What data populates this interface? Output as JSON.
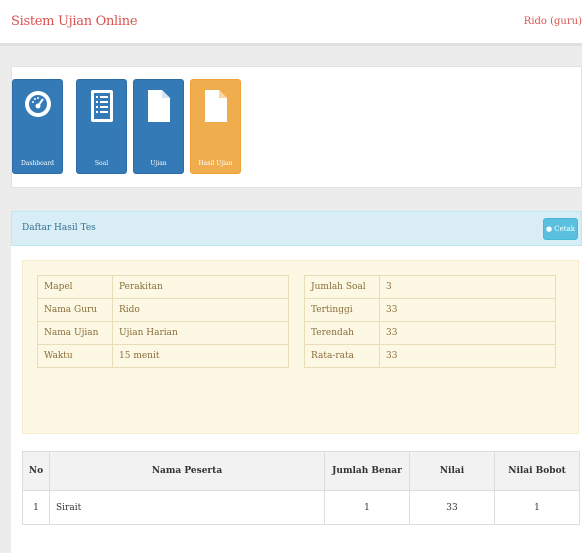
{
  "header": {
    "title": "Sistem Ujian Online",
    "user": "Rido (guru)"
  },
  "menu": {
    "tiles": [
      {
        "label": "Dashboard",
        "icon": "dashboard-icon",
        "color": "#337ab7"
      },
      {
        "label": "Soal",
        "icon": "list-icon",
        "color": "#337ab7"
      },
      {
        "label": "Ujian",
        "icon": "file-icon",
        "color": "#337ab7"
      },
      {
        "label": "Hasil Ujian",
        "icon": "file-icon",
        "color": "#f0ad4e"
      }
    ]
  },
  "panel": {
    "title": "Daftar Hasil Tes",
    "print_button": "Cetak"
  },
  "info": {
    "left": [
      {
        "label": "Mapel",
        "value": "Perakitan"
      },
      {
        "label": "Nama Guru",
        "value": "Rido"
      },
      {
        "label": "Nama Ujian",
        "value": "Ujian Harian"
      },
      {
        "label": "Waktu",
        "value": "15 menit"
      }
    ],
    "right": [
      {
        "label": "Jumlah Soal",
        "value": "3"
      },
      {
        "label": "Tertinggi",
        "value": "33"
      },
      {
        "label": "Terendah",
        "value": "33"
      },
      {
        "label": "Rata-rata",
        "value": "33"
      }
    ]
  },
  "results": {
    "columns": [
      "No",
      "Nama Peserta",
      "Jumlah Benar",
      "Nilai",
      "Nilai Bobot"
    ],
    "rows": [
      {
        "no": "1",
        "nama": "Sirait",
        "benar": "1",
        "nilai": "33",
        "bobot": "1"
      }
    ]
  }
}
